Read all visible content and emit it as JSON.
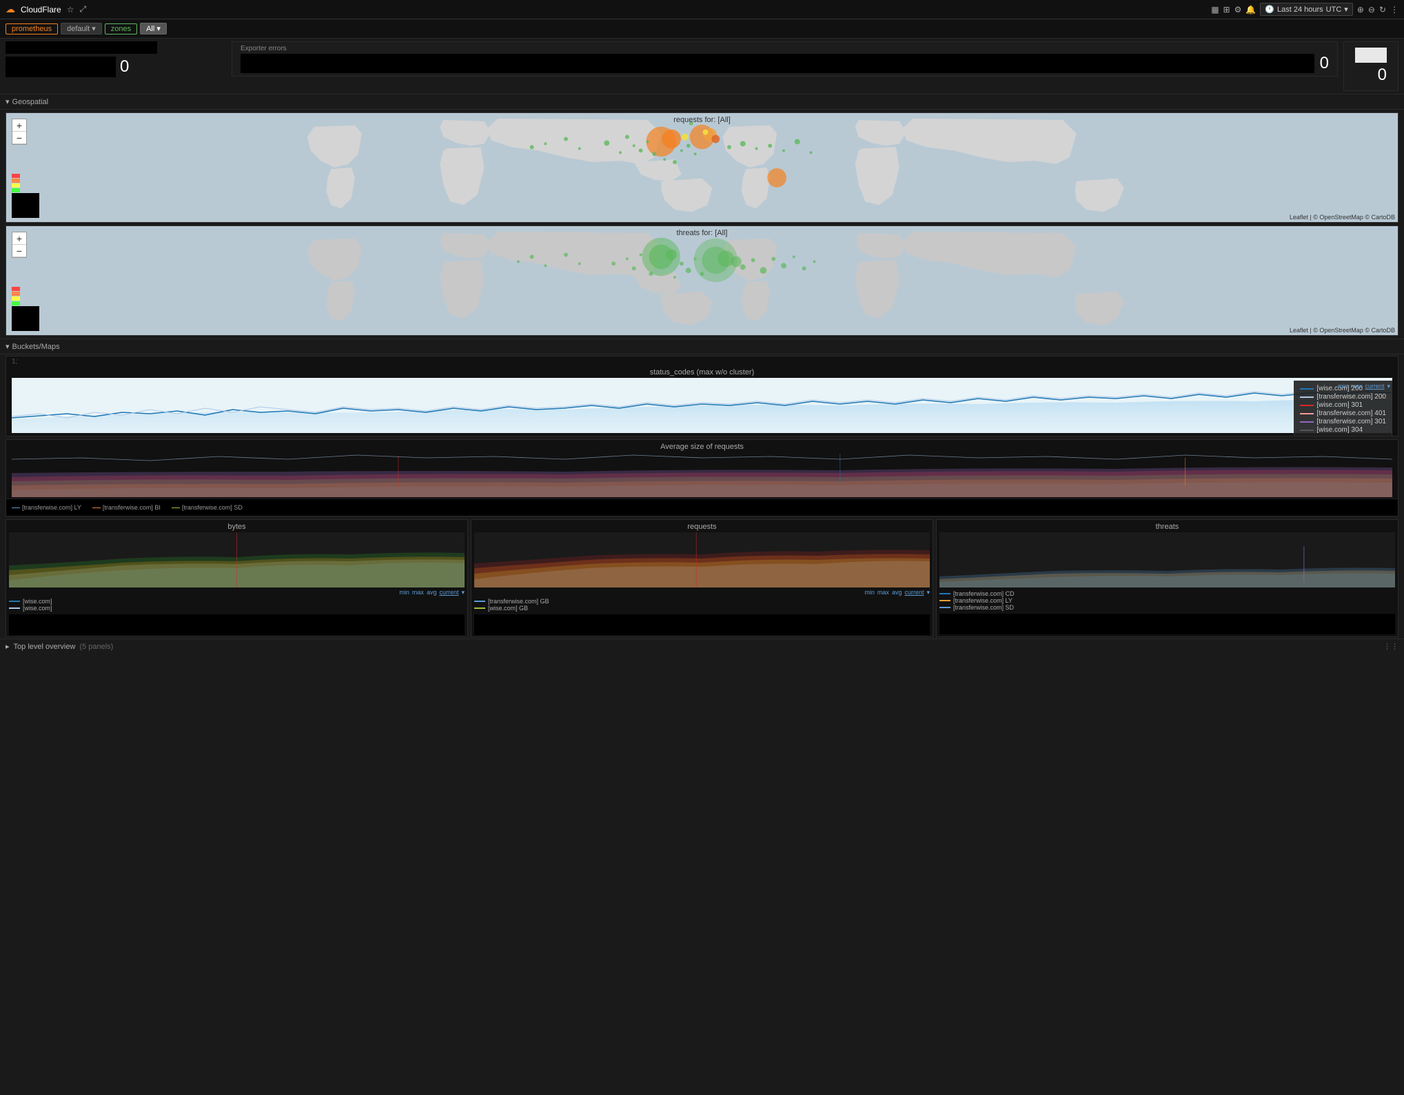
{
  "app": {
    "title": "CloudFlare",
    "icon": "☁"
  },
  "topbar": {
    "time_range": "Last 24 hours",
    "timezone": "UTC",
    "icons": [
      "bar-chart-icon",
      "table-icon",
      "gear-icon",
      "bell-icon",
      "refresh-icon",
      "zoom-in-icon",
      "zoom-out-icon",
      "menu-icon"
    ]
  },
  "tags": {
    "prometheus": "prometheus",
    "default": "default",
    "zones": "zones",
    "all": "All"
  },
  "stats": {
    "exporter_errors_label": "Exporter errors",
    "exporter_errors_value": "0",
    "right_value": "0"
  },
  "geospatial": {
    "section_label": "Geospatial",
    "map1_title": "requests for: [All]",
    "map2_title": "threats for: [All]",
    "attribution": "Leaflet | © OpenStreetMap © CartoDB",
    "zoom_in": "+",
    "zoom_out": "−"
  },
  "buckets": {
    "section_label": "Buckets/Maps",
    "status_codes_title": "status_codes (max w/o cluster)",
    "avg_size_title": "Average size of requests",
    "legend": {
      "min": "min",
      "max": "max",
      "current": "current"
    },
    "series": [
      {
        "label": "[wise.com] 200",
        "color": "#1f77b4"
      },
      {
        "label": "[transferwise.com] 200",
        "color": "#aec7e8"
      },
      {
        "label": "[wise.com] 301",
        "color": "#d62728"
      },
      {
        "label": "[transferwise.com] 401",
        "color": "#ff9896"
      },
      {
        "label": "[transferwise.com] 301",
        "color": "#9467bd"
      },
      {
        "label": "[wise.com] 304",
        "color": "#333"
      }
    ],
    "avg_labels": [
      {
        "label": "[transferwise.com] LY",
        "color": "#5b9bd5"
      },
      {
        "label": "[transferwise.com] BI",
        "color": "#e8843a"
      },
      {
        "label": "[transferwise.com] SD",
        "color": "#a0c040"
      }
    ]
  },
  "small_panels": {
    "bytes_title": "bytes",
    "requests_title": "requests",
    "threats_title": "threats",
    "bytes_series": [
      {
        "label": "[wise.com]",
        "color": "#1f77b4"
      },
      {
        "label": "[wise.com]",
        "color": "#aec7e8"
      }
    ],
    "requests_series": [
      {
        "label": "[transferwise.com] GB",
        "color": "#5b9bd5"
      },
      {
        "label": "[wise.com] GB",
        "color": "#a0c040"
      }
    ],
    "threats_series": [
      {
        "label": "[transferwise.com] CD",
        "color": "#1f77b4"
      },
      {
        "label": "[transferwise.com] LY",
        "color": "#f0a030"
      },
      {
        "label": "[transferwise.com] SD",
        "color": "#5b9bd5"
      }
    ]
  },
  "footer": {
    "label": "Top level overview",
    "panels_count": "(5 panels)"
  }
}
